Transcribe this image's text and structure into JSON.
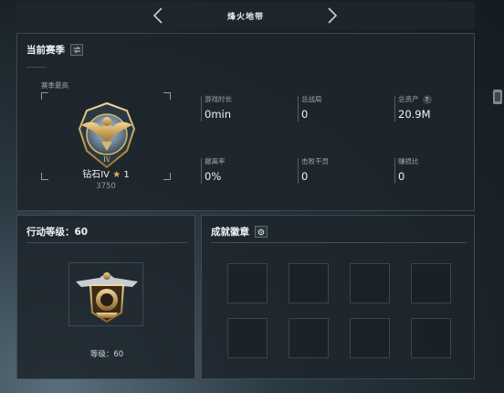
{
  "header": {
    "title": "烽火地带"
  },
  "season": {
    "title": "当前赛季",
    "best_label": "赛季最高",
    "rank_name": "钻石IV",
    "rank_star": "★",
    "rank_stars_count": "1",
    "rank_score": "3750",
    "stats": [
      {
        "label": "游戏时长",
        "value": "0min"
      },
      {
        "label": "总战局",
        "value": "0"
      },
      {
        "label": "总资产",
        "value": "20.9M",
        "help": "?"
      },
      {
        "label": "撤离率",
        "value": "0%"
      },
      {
        "label": "击败干员",
        "value": "0"
      },
      {
        "label": "赚损比",
        "value": "0"
      }
    ]
  },
  "level": {
    "title": "行动等级：60",
    "level_text": "等级：60"
  },
  "badges": {
    "title": "成就徽章",
    "slots": 8
  },
  "colors": {
    "accent_gold": "#e3b55a",
    "panel_bg": "#1e262c",
    "text": "#eef2f5"
  },
  "icons": [
    "chevron-left-icon",
    "chevron-right-icon",
    "swap-icon",
    "settings-icon",
    "help-icon",
    "star-icon"
  ]
}
